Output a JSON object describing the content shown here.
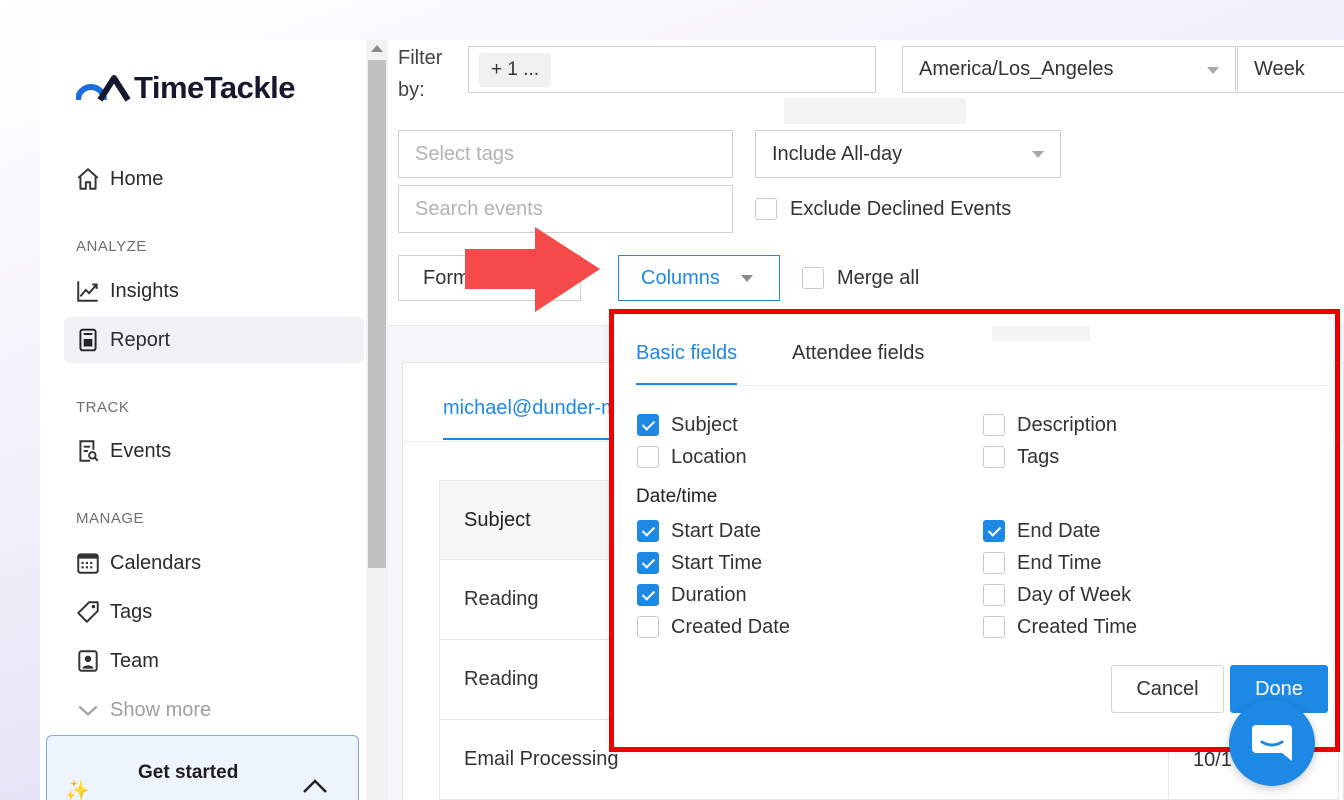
{
  "app": {
    "logo_text": "TimeTackle",
    "brand_color": "#1e88e5",
    "highlight_color": "#ee0000"
  },
  "sidebar": {
    "home": "Home",
    "sections": {
      "analyze": "ANALYZE",
      "track": "TRACK",
      "manage": "MANAGE"
    },
    "items": {
      "insights": "Insights",
      "report": "Report",
      "events": "Events",
      "calendars": "Calendars",
      "tags": "Tags",
      "team": "Team"
    },
    "show_more": "Show more",
    "get_started": "Get started"
  },
  "filters": {
    "filter_label": "Filter by:",
    "filter_chip": "+ 1 ...",
    "timezone": "America/Los_Angeles",
    "period": "Week",
    "tags_placeholder": "Select tags",
    "search_placeholder": "Search events",
    "all_day": "Include All-day",
    "exclude_declined": "Exclude Declined Events",
    "exclude_declined_checked": false,
    "format_label": "Form",
    "columns_label": "Columns",
    "merge_all": "Merge all",
    "merge_all_checked": false
  },
  "report": {
    "account_tab": "michael@dunder-m",
    "header_subject": "Subject",
    "rows": [
      {
        "subject": "Reading",
        "date": ""
      },
      {
        "subject": "Reading",
        "date": ""
      },
      {
        "subject": "Email Processing",
        "date": "10/1"
      }
    ]
  },
  "columns_dropdown": {
    "tabs": [
      "Basic fields",
      "Attendee fields"
    ],
    "active_tab": "Basic fields",
    "basic": [
      {
        "label": "Subject",
        "checked": true
      },
      {
        "label": "Description",
        "checked": false
      },
      {
        "label": "Location",
        "checked": false
      },
      {
        "label": "Tags",
        "checked": false
      }
    ],
    "datetime_heading": "Date/time",
    "datetime": [
      {
        "label": "Start Date",
        "checked": true
      },
      {
        "label": "End Date",
        "checked": true
      },
      {
        "label": "Start Time",
        "checked": true
      },
      {
        "label": "End Time",
        "checked": false
      },
      {
        "label": "Duration",
        "checked": true
      },
      {
        "label": "Day of Week",
        "checked": false
      },
      {
        "label": "Created Date",
        "checked": false
      },
      {
        "label": "Created Time",
        "checked": false
      }
    ],
    "cancel": "Cancel",
    "done": "Done"
  }
}
